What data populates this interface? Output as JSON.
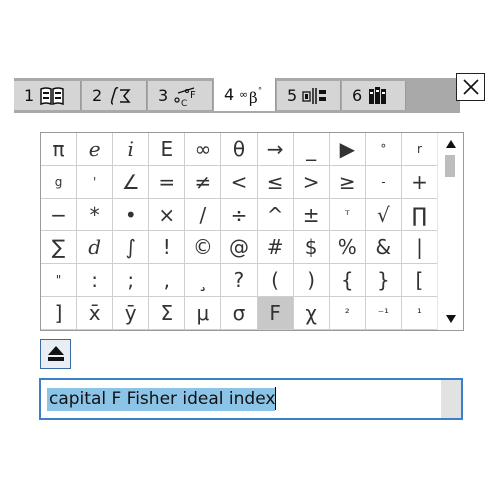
{
  "tabs": [
    {
      "number": "1",
      "icon": "catalog-book-icon",
      "active": false
    },
    {
      "number": "2",
      "icon": "calculus-template-icon",
      "active": false
    },
    {
      "number": "3",
      "icon": "units-icon",
      "active": false
    },
    {
      "number": "4",
      "icon": "math-symbols-icon",
      "active": true
    },
    {
      "number": "5",
      "icon": "library-icon",
      "active": false
    },
    {
      "number": "6",
      "icon": "books-icon",
      "active": false
    }
  ],
  "palette": {
    "rows": [
      [
        "π",
        "e",
        "i",
        "E",
        "∞",
        "θ",
        "→",
        "_",
        "▶",
        "°",
        "r"
      ],
      [
        "g",
        "'",
        "∠",
        "=",
        "≠",
        "<",
        "≤",
        ">",
        "≥",
        "-",
        "+"
      ],
      [
        "−",
        "*",
        "•",
        "×",
        "/",
        "÷",
        "^",
        "±",
        "ᵀ",
        "√",
        "∏"
      ],
      [
        "∑",
        "d",
        "∫",
        "!",
        "©",
        "@",
        "#",
        "$",
        "%",
        "&",
        "|"
      ],
      [
        "\"",
        ":",
        ";",
        ",",
        "¸",
        "?",
        "(",
        ")",
        "{",
        "}",
        "["
      ],
      [
        "]",
        "x̄",
        "ȳ",
        "Σ",
        "μ",
        "σ",
        "F",
        "χ",
        "²",
        "⁻¹",
        "¹"
      ]
    ],
    "selected_symbol": "F"
  },
  "search": {
    "value": "capital F Fisher ideal index"
  },
  "colors": {
    "selection_highlight": "#8cc4e8",
    "focus_border": "#3a7fc9",
    "selected_cell": "#c8c8c8"
  }
}
